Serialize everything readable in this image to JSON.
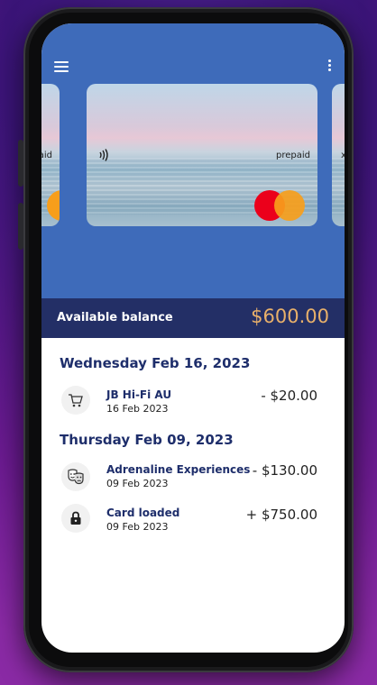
{
  "header": {
    "menu_icon": "hamburger-menu-icon",
    "more_icon": "vertical-dots-icon"
  },
  "cards": {
    "left_text": "aid",
    "main": {
      "type_label": "prepaid",
      "contactless_icon": "contactless-icon",
      "brand": "mastercard-logo"
    },
    "right_text": "x"
  },
  "balance": {
    "label": "Available balance",
    "amount": "$600.00"
  },
  "transactions": [
    {
      "day": "Wednesday Feb 16, 2023",
      "items": [
        {
          "icon": "shopping-cart-icon",
          "title": "JB Hi-Fi AU",
          "date": "16 Feb 2023",
          "amount": "- $20.00"
        }
      ]
    },
    {
      "day": "Thursday Feb 09, 2023",
      "items": [
        {
          "icon": "theater-masks-icon",
          "title": "Adrenaline Experiences",
          "date": "09 Feb 2023",
          "amount": "- $130.00"
        },
        {
          "icon": "lock-icon",
          "title": "Card loaded",
          "date": "09 Feb 2023",
          "amount": "+ $750.00"
        }
      ]
    }
  ],
  "colors": {
    "header_bg": "#3e6bba",
    "balance_bar": "#232f66",
    "balance_amount": "#e8b06a",
    "accent_text": "#1e2e6b"
  }
}
